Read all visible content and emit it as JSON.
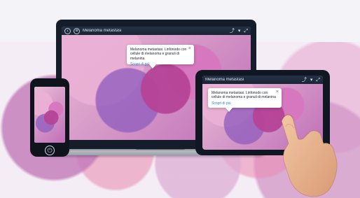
{
  "viewer": {
    "title": "Melanoma metastasi",
    "actions": [
      "share",
      "filter",
      "fullscreen"
    ]
  },
  "popover": {
    "text": "Melanoma metastasi. Linfonodo con cellule di melanoma e granuli di melanina",
    "link": "Scopri di più"
  },
  "phone": {
    "home_symbol": "⏻"
  },
  "icons": {
    "back": "‹",
    "menu": "≡",
    "close": "×",
    "share": "⤴",
    "filter": "▾",
    "fullscreen": "⤢"
  }
}
